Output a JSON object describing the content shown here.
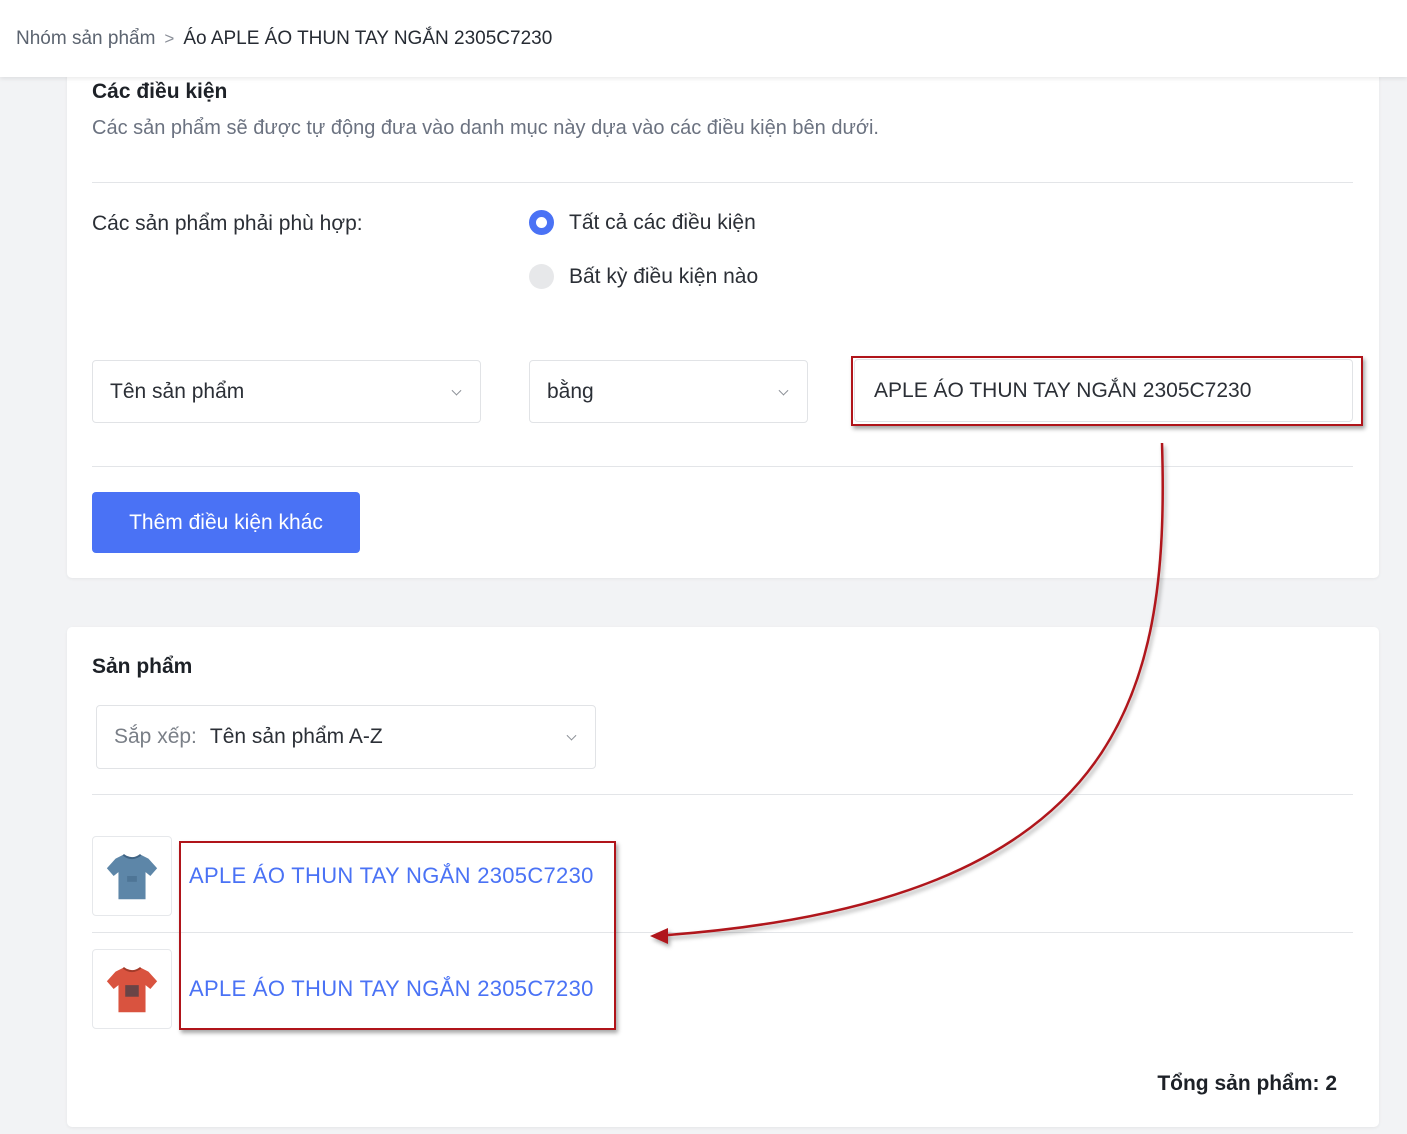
{
  "breadcrumb": {
    "parent": "Nhóm sản phẩm",
    "separator": ">",
    "current": "Áo APLE ÁO THUN TAY NGẮN 2305C7230"
  },
  "conditions": {
    "title": "Các điều kiện",
    "description": "Các sản phẩm sẽ được tự động đưa vào danh mục này dựa vào các điều kiện bên dưới.",
    "match_label": "Các sản phẩm phải phù hợp:",
    "options": [
      {
        "label": "Tất cả các điều kiện",
        "selected": true
      },
      {
        "label": "Bất kỳ điều kiện nào",
        "selected": false
      }
    ],
    "rule": {
      "field": "Tên sản phẩm",
      "operator": "bằng",
      "value": "APLE ÁO THUN TAY NGẮN 2305C7230"
    },
    "add_button": "Thêm điều kiện khác"
  },
  "products": {
    "title": "Sản phẩm",
    "sort_prefix": "Sắp xếp:",
    "sort_value": "Tên sản phẩm A-Z",
    "items": [
      {
        "name": "APLE ÁO THUN TAY NGẮN 2305C7230",
        "thumb_color": "#5d86a8",
        "icon": "tshirt-icon"
      },
      {
        "name": "APLE ÁO THUN TAY NGẮN 2305C7230",
        "thumb_color": "#d9533f",
        "icon": "tshirt-icon"
      }
    ],
    "total": "Tổng sản phẩm: 2"
  },
  "colors": {
    "accent": "#4a72f5",
    "annotation": "#b0141a"
  }
}
